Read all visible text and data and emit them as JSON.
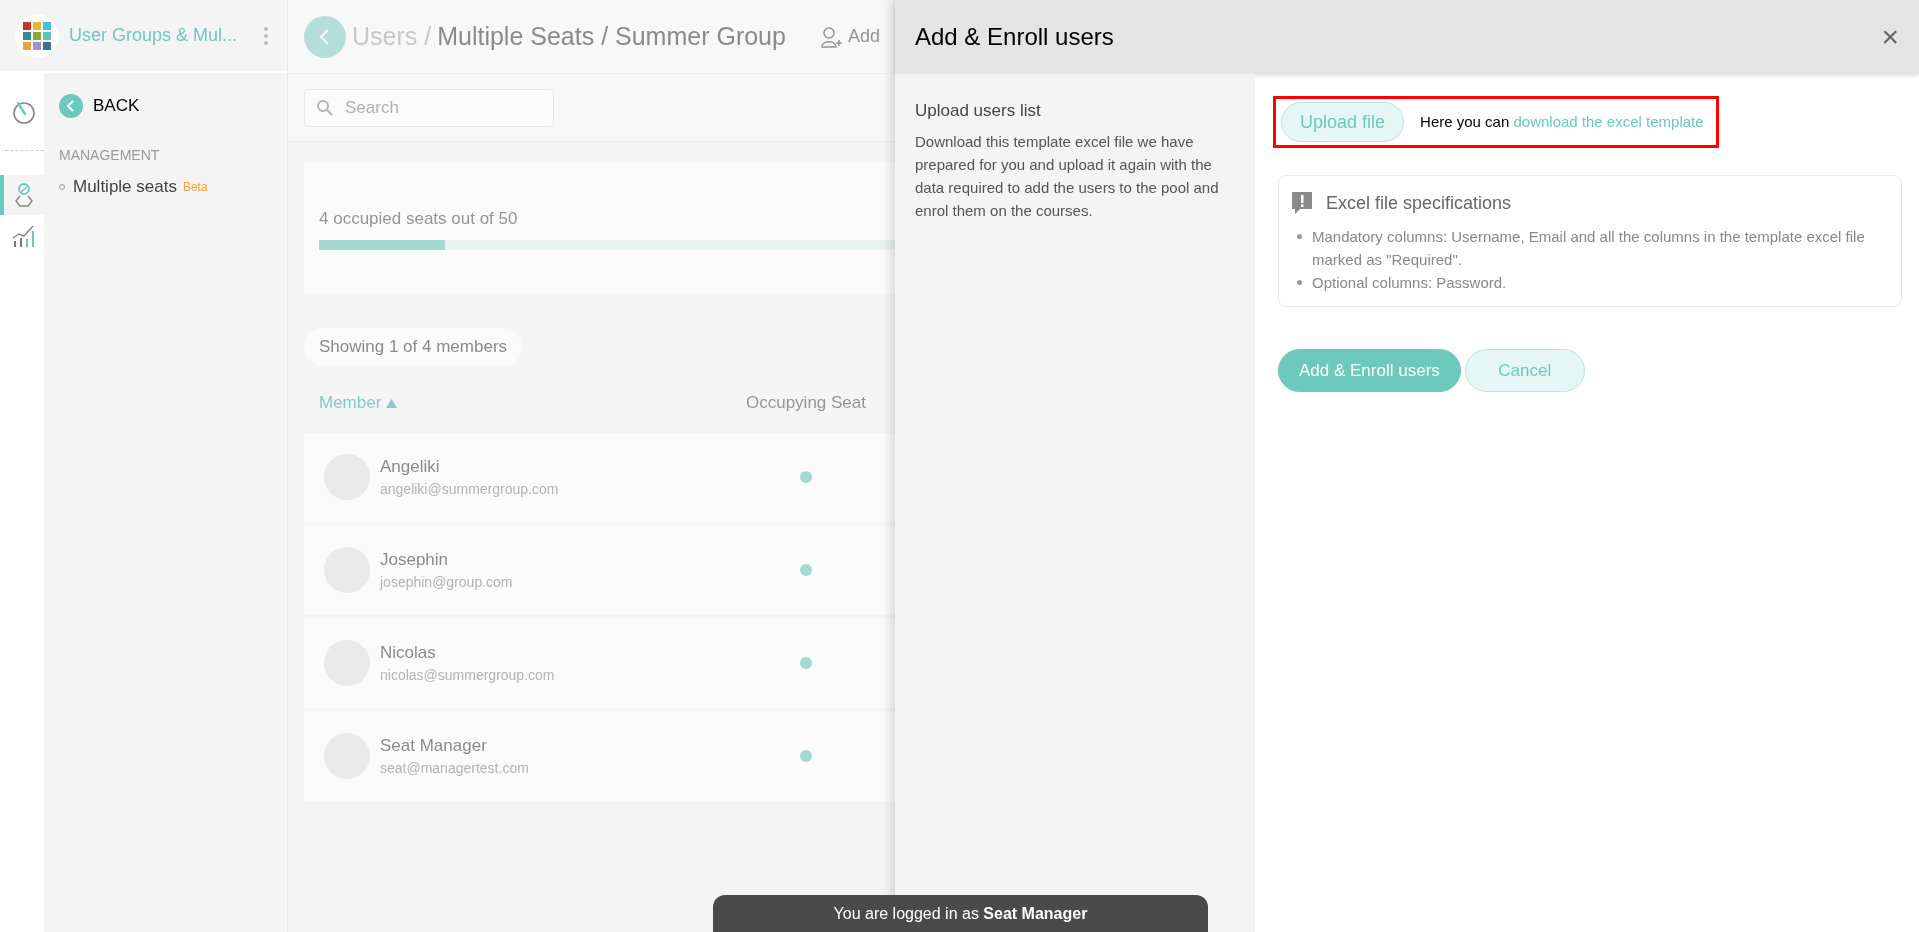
{
  "app": {
    "title": "User Groups & Mul..."
  },
  "rail": [
    {
      "kind": "gauge",
      "selected": false
    },
    {
      "kind": "user",
      "selected": true
    },
    {
      "kind": "chart",
      "selected": false
    }
  ],
  "sidebar": {
    "back": "BACK",
    "section": "MANAGEMENT",
    "items": [
      {
        "label": "Multiple seats",
        "badge": "Beta"
      }
    ]
  },
  "header": {
    "breadcrumb": [
      {
        "label": "Users /",
        "current": false
      },
      {
        "label": "Multiple Seats / Summer Group",
        "current": true
      }
    ],
    "add_button": "Add"
  },
  "search": {
    "placeholder": "Search"
  },
  "seats": {
    "text": "4 occupied seats out of 50",
    "level": 0.08
  },
  "showing": "Showing 1 of 4 members",
  "table": {
    "columns": [
      {
        "label": "Member",
        "sorted": true
      },
      {
        "label": "Occupying Seat",
        "sorted": false
      }
    ],
    "rows": [
      {
        "name": "Angeliki",
        "email": "angeliki@summergroup.com",
        "occupying": true
      },
      {
        "name": "Josephin",
        "email": "josephin@group.com",
        "occupying": true
      },
      {
        "name": "Nicolas",
        "email": "nicolas@summergroup.com",
        "occupying": true
      },
      {
        "name": "Seat Manager",
        "email": "seat@managertest.com",
        "occupying": true
      }
    ]
  },
  "panel": {
    "title": "Add & Enroll users",
    "close": "×",
    "heading": "Upload users list",
    "description": "Download this template excel file we have prepared for you and upload it again with the data required to add the users to the pool and enrol them on the courses.",
    "upload_button": "Upload file",
    "hint": "Here you can",
    "link": "download the excel template",
    "highlighted": true,
    "specs": {
      "title": "Excel file specifications",
      "items": [
        "Mandatory columns: Username, Email and all the columns in the template excel file marked as \"Required\".",
        "Optional columns: Password."
      ]
    },
    "actions": [
      {
        "label": "Add & Enroll users",
        "kind": "primary"
      },
      {
        "label": "Cancel",
        "kind": "secondary"
      }
    ]
  },
  "toast": "You are logged in as **Seat Manager**"
}
